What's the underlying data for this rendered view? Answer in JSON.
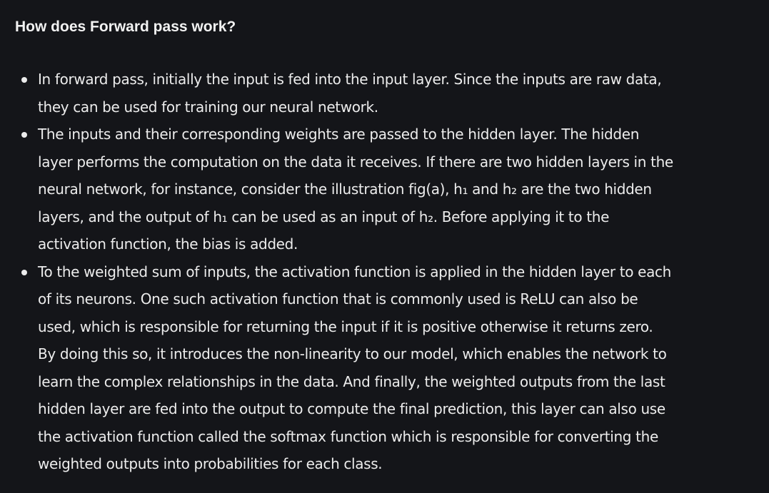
{
  "title": "How does Forward pass work?",
  "bullets": [
    {
      "lines": [
        "In forward pass, initially the input is fed into the input layer. Since the inputs are raw data,",
        "they can be used for training our neural network."
      ]
    },
    {
      "lines": [
        "The inputs and their corresponding weights are passed to the hidden layer. The hidden",
        "layer performs the computation on the data it receives. If there are two hidden layers in the",
        "neural network, for instance, consider the illustration fig(a), h₁ and h₂ are the two hidden",
        "layers, and the output of h₁ can be used as an input of h₂. Before applying it to the",
        "activation function, the bias is added."
      ]
    },
    {
      "lines": [
        "To the weighted sum of inputs, the activation function is applied in the hidden layer to each",
        "of its neurons. One such activation function that is commonly used is ReLU can also be",
        "used, which is responsible for returning the input if it is positive otherwise it returns zero.",
        "By doing this so, it introduces the non-linearity to our model, which enables the network to",
        "learn the complex relationships in the data. And finally, the weighted outputs from the last",
        "hidden layer are fed into the output to compute the final prediction, this layer can also use",
        "the activation function called the softmax function which is responsible for converting the",
        "weighted outputs into probabilities for each class."
      ]
    }
  ]
}
